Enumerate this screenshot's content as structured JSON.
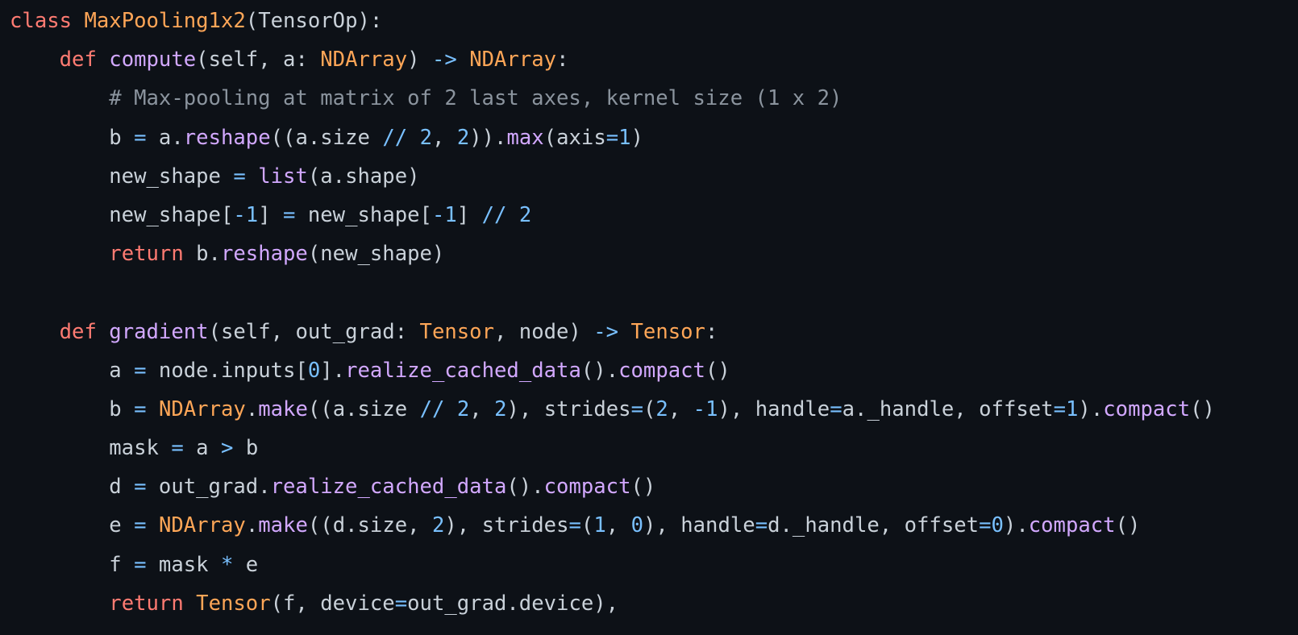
{
  "code": {
    "language": "python",
    "colors": {
      "background": "#0d1117",
      "text": "#c9d1d9",
      "keyword": "#ff7b72",
      "classname": "#ffa657",
      "function": "#d2a8ff",
      "type": "#ffa657",
      "operator": "#79c0ff",
      "number": "#79c0ff",
      "comment": "#8b949e"
    },
    "lines": [
      [
        [
          "keyword",
          "class"
        ],
        [
          "text",
          " "
        ],
        [
          "classname",
          "MaxPooling1x2"
        ],
        [
          "text",
          "(TensorOp):"
        ]
      ],
      [
        [
          "text",
          "    "
        ],
        [
          "keyword",
          "def"
        ],
        [
          "text",
          " "
        ],
        [
          "func",
          "compute"
        ],
        [
          "text",
          "(self, a: "
        ],
        [
          "type",
          "NDArray"
        ],
        [
          "text",
          ") "
        ],
        [
          "op",
          "->"
        ],
        [
          "text",
          " "
        ],
        [
          "type",
          "NDArray"
        ],
        [
          "text",
          ":"
        ]
      ],
      [
        [
          "text",
          "        "
        ],
        [
          "comment",
          "# Max-pooling at matrix of 2 last axes, kernel size (1 x 2)"
        ]
      ],
      [
        [
          "text",
          "        b "
        ],
        [
          "op",
          "="
        ],
        [
          "text",
          " a."
        ],
        [
          "func",
          "reshape"
        ],
        [
          "text",
          "((a.size "
        ],
        [
          "op",
          "//"
        ],
        [
          "text",
          " "
        ],
        [
          "num",
          "2"
        ],
        [
          "text",
          ", "
        ],
        [
          "num",
          "2"
        ],
        [
          "text",
          "))."
        ],
        [
          "func",
          "max"
        ],
        [
          "text",
          "(axis"
        ],
        [
          "op",
          "="
        ],
        [
          "num",
          "1"
        ],
        [
          "text",
          ")"
        ]
      ],
      [
        [
          "text",
          "        new_shape "
        ],
        [
          "op",
          "="
        ],
        [
          "text",
          " "
        ],
        [
          "func",
          "list"
        ],
        [
          "text",
          "(a.shape)"
        ]
      ],
      [
        [
          "text",
          "        new_shape["
        ],
        [
          "op",
          "-"
        ],
        [
          "num",
          "1"
        ],
        [
          "text",
          "] "
        ],
        [
          "op",
          "="
        ],
        [
          "text",
          " new_shape["
        ],
        [
          "op",
          "-"
        ],
        [
          "num",
          "1"
        ],
        [
          "text",
          "] "
        ],
        [
          "op",
          "//"
        ],
        [
          "text",
          " "
        ],
        [
          "num",
          "2"
        ]
      ],
      [
        [
          "text",
          "        "
        ],
        [
          "keyword",
          "return"
        ],
        [
          "text",
          " b."
        ],
        [
          "func",
          "reshape"
        ],
        [
          "text",
          "(new_shape)"
        ]
      ],
      [
        [
          "text",
          ""
        ]
      ],
      [
        [
          "text",
          "    "
        ],
        [
          "keyword",
          "def"
        ],
        [
          "text",
          " "
        ],
        [
          "func",
          "gradient"
        ],
        [
          "text",
          "(self, out_grad: "
        ],
        [
          "type",
          "Tensor"
        ],
        [
          "text",
          ", node) "
        ],
        [
          "op",
          "->"
        ],
        [
          "text",
          " "
        ],
        [
          "type",
          "Tensor"
        ],
        [
          "text",
          ":"
        ]
      ],
      [
        [
          "text",
          "        a "
        ],
        [
          "op",
          "="
        ],
        [
          "text",
          " node.inputs["
        ],
        [
          "num",
          "0"
        ],
        [
          "text",
          "]."
        ],
        [
          "func",
          "realize_cached_data"
        ],
        [
          "text",
          "()."
        ],
        [
          "func",
          "compact"
        ],
        [
          "text",
          "()"
        ]
      ],
      [
        [
          "text",
          "        b "
        ],
        [
          "op",
          "="
        ],
        [
          "text",
          " "
        ],
        [
          "type",
          "NDArray"
        ],
        [
          "text",
          "."
        ],
        [
          "func",
          "make"
        ],
        [
          "text",
          "((a.size "
        ],
        [
          "op",
          "//"
        ],
        [
          "text",
          " "
        ],
        [
          "num",
          "2"
        ],
        [
          "text",
          ", "
        ],
        [
          "num",
          "2"
        ],
        [
          "text",
          "), strides"
        ],
        [
          "op",
          "="
        ],
        [
          "text",
          "("
        ],
        [
          "num",
          "2"
        ],
        [
          "text",
          ", "
        ],
        [
          "op",
          "-"
        ],
        [
          "num",
          "1"
        ],
        [
          "text",
          "), handle"
        ],
        [
          "op",
          "="
        ],
        [
          "text",
          "a._handle, offset"
        ],
        [
          "op",
          "="
        ],
        [
          "num",
          "1"
        ],
        [
          "text",
          ")."
        ],
        [
          "func",
          "compact"
        ],
        [
          "text",
          "()"
        ]
      ],
      [
        [
          "text",
          "        mask "
        ],
        [
          "op",
          "="
        ],
        [
          "text",
          " a "
        ],
        [
          "op",
          ">"
        ],
        [
          "text",
          " b"
        ]
      ],
      [
        [
          "text",
          "        d "
        ],
        [
          "op",
          "="
        ],
        [
          "text",
          " out_grad."
        ],
        [
          "func",
          "realize_cached_data"
        ],
        [
          "text",
          "()."
        ],
        [
          "func",
          "compact"
        ],
        [
          "text",
          "()"
        ]
      ],
      [
        [
          "text",
          "        e "
        ],
        [
          "op",
          "="
        ],
        [
          "text",
          " "
        ],
        [
          "type",
          "NDArray"
        ],
        [
          "text",
          "."
        ],
        [
          "func",
          "make"
        ],
        [
          "text",
          "((d.size, "
        ],
        [
          "num",
          "2"
        ],
        [
          "text",
          "), strides"
        ],
        [
          "op",
          "="
        ],
        [
          "text",
          "("
        ],
        [
          "num",
          "1"
        ],
        [
          "text",
          ", "
        ],
        [
          "num",
          "0"
        ],
        [
          "text",
          "), handle"
        ],
        [
          "op",
          "="
        ],
        [
          "text",
          "d._handle, offset"
        ],
        [
          "op",
          "="
        ],
        [
          "num",
          "0"
        ],
        [
          "text",
          ")."
        ],
        [
          "func",
          "compact"
        ],
        [
          "text",
          "()"
        ]
      ],
      [
        [
          "text",
          "        f "
        ],
        [
          "op",
          "="
        ],
        [
          "text",
          " mask "
        ],
        [
          "op",
          "*"
        ],
        [
          "text",
          " e"
        ]
      ],
      [
        [
          "text",
          "        "
        ],
        [
          "keyword",
          "return"
        ],
        [
          "text",
          " "
        ],
        [
          "type",
          "Tensor"
        ],
        [
          "text",
          "(f, device"
        ],
        [
          "op",
          "="
        ],
        [
          "text",
          "out_grad.device),"
        ]
      ]
    ]
  }
}
